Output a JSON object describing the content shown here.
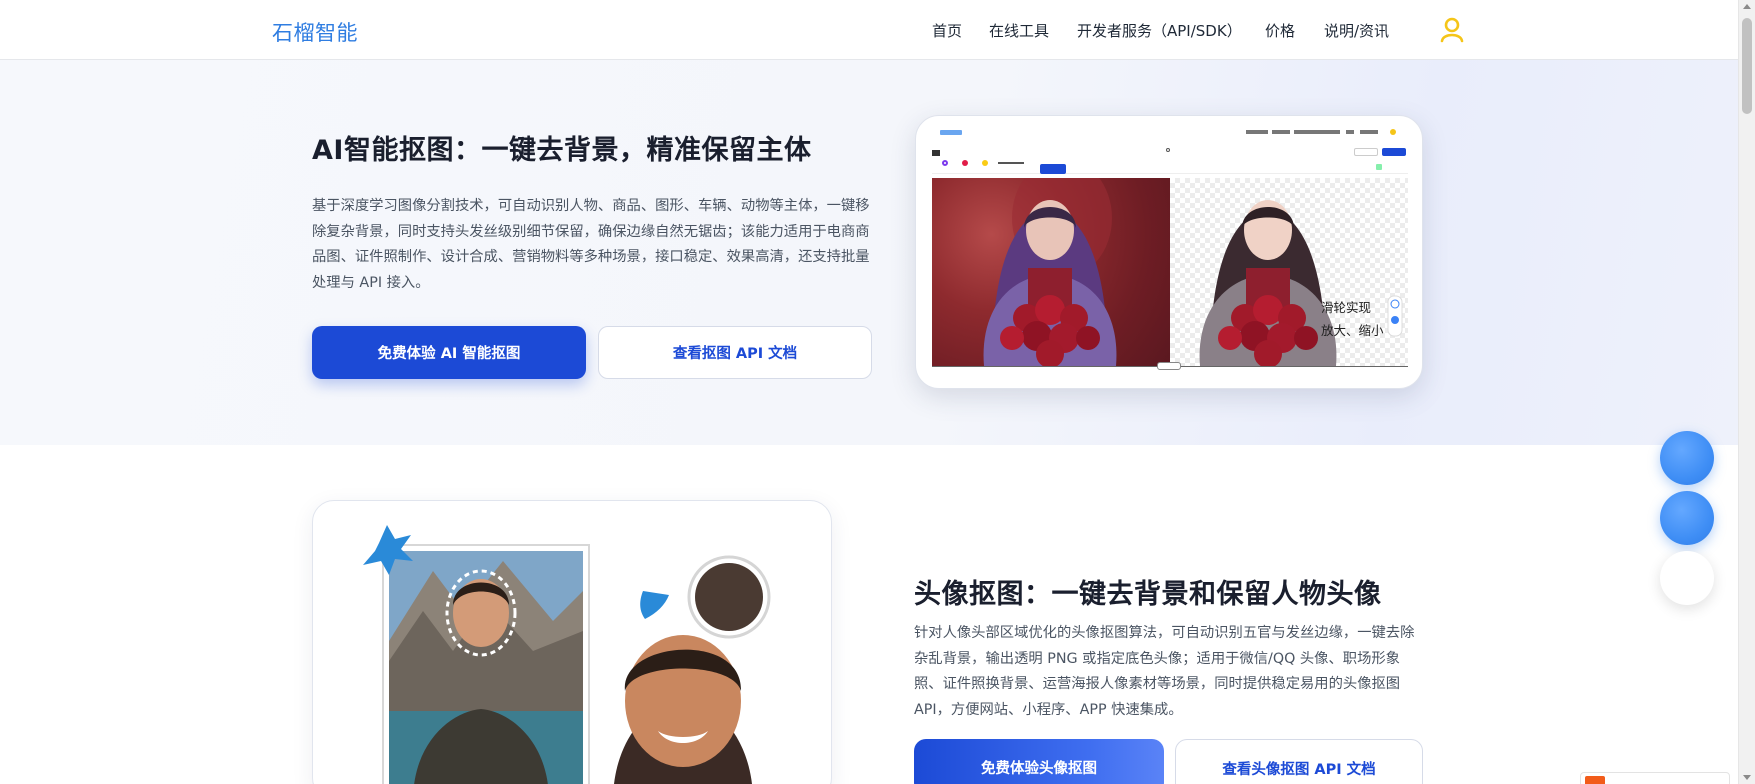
{
  "header": {
    "logo": "石榴智能",
    "nav": [
      {
        "label": "首页"
      },
      {
        "label": "在线工具"
      },
      {
        "label": "开发者服务（API/SDK）"
      },
      {
        "label": "价格"
      },
      {
        "label": "说明/资讯"
      }
    ],
    "user_icon": "user-icon",
    "accent_color": "#f5c518"
  },
  "hero1": {
    "title": "AI智能抠图：一键去背景，精准保留主体",
    "description": "基于深度学习图像分割技术，可自动识别人物、商品、图形、车辆、动物等主体，一键移除复杂背景，同时支持头发丝级别细节保留，确保边缘自然无锯齿；该能力适用于电商商品图、证件照制作、设计合成、营销物料等多种场景，接口稳定、效果高清，还支持批量处理与 API 接入。",
    "primary_button": "免费体验 AI 智能抠图",
    "secondary_button": "查看抠图 API 文档",
    "preview": {
      "caption_line1": "滑轮实现",
      "caption_line2": "放大、缩小"
    }
  },
  "section2": {
    "title": "头像抠图：一键去背景和保留人物头像",
    "description": "针对人像头部区域优化的头像抠图算法，可自动识别五官与发丝边缘，一键去除杂乱背景，输出透明 PNG 或指定底色头像；适用于微信/QQ 头像、职场形象照、证件照换背景、运营海报人像素材等场景，同时提供稳定易用的头像抠图 API，方便网站、小程序、APP 快速集成。",
    "primary_button": "免费体验头像抠图",
    "secondary_button": "查看头像抠图 API 文档"
  },
  "colors": {
    "brand_blue": "#1c4ad6",
    "logo_blue": "#2f7de1",
    "float_blue": "#3f8ef5"
  }
}
